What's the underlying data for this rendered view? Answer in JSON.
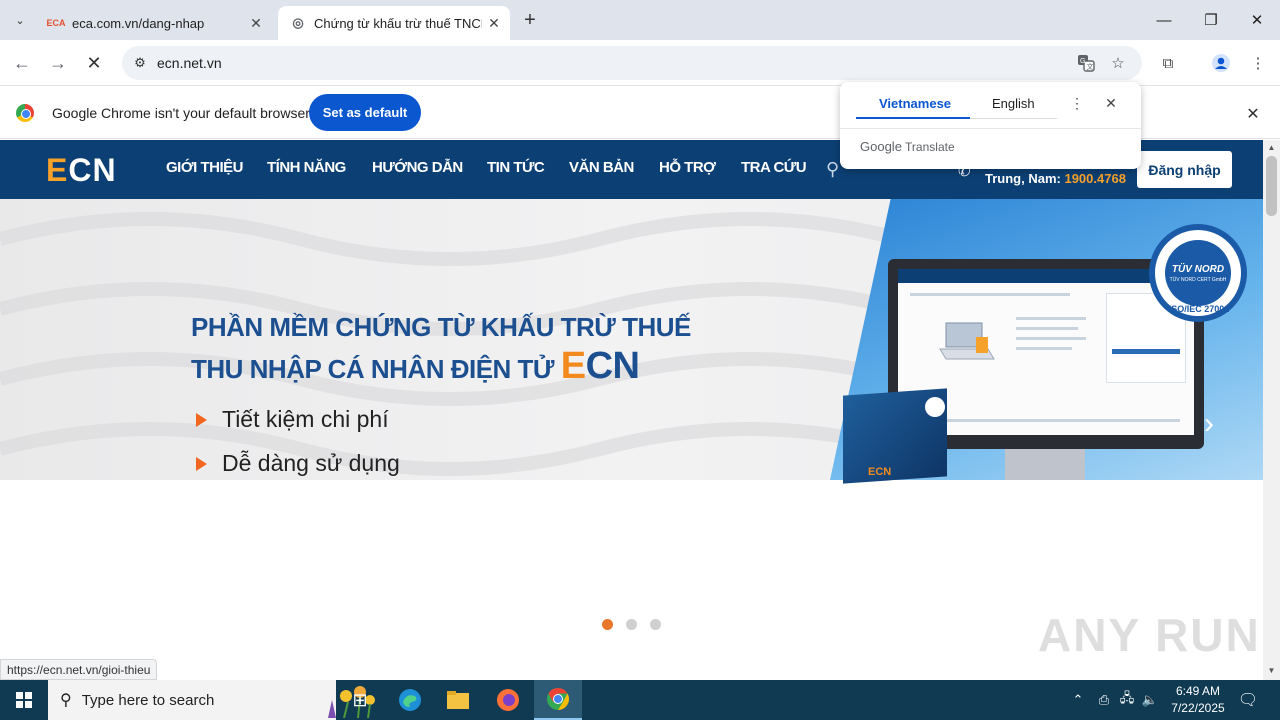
{
  "browser": {
    "tabs": [
      {
        "favicon": "ECA",
        "title": "eca.com.vn/dang-nhap"
      },
      {
        "favicon": "globe-icon",
        "title": "Chứng từ khấu trừ thuế TNCN điện tử"
      }
    ],
    "url": "ecn.net.vn",
    "infobar": {
      "text": "Google Chrome isn't your default browser",
      "button": "Set as default"
    },
    "status_url": "https://ecn.net.vn/gioi-thieu"
  },
  "translate_popup": {
    "tabs": [
      "Vietnamese",
      "English"
    ],
    "selected": "Vietnamese",
    "brand": "Google",
    "product": "Translate"
  },
  "site": {
    "logo_e": "E",
    "logo_rest": "CN",
    "menu": [
      "GIỚI THIỆU",
      "TÍNH NĂNG",
      "HƯỚNG DẪN",
      "TIN TỨC",
      "VĂN BẢN",
      "HỖ TRỢ",
      "TRA CỨU"
    ],
    "hotline_label": "Trung, Nam:",
    "hotline_number": "1900.4768",
    "login": "Đăng nhập",
    "banner": {
      "line1": "PHẦN MỀM CHỨNG TỪ KHẤU TRỪ THUẾ",
      "line2": "THU NHẬP CÁ NHÂN ĐIỆN TỬ",
      "brand_e": "E",
      "brand_rest": "CN",
      "bullets": [
        "Tiết kiệm chi phí",
        "Dễ dàng sử dụng"
      ],
      "box_label": "ECN",
      "cert_name": "TÜV NORD",
      "cert_sub": "TÜV NORD CERT GmbH",
      "cert_iso": "ISO/IEC 27001"
    },
    "carousel": {
      "count": 3,
      "active": 0,
      "active_color": "#e8762b",
      "inactive_color": "#cfcfcf"
    }
  },
  "watermark": "ANY RUN",
  "taskbar": {
    "search_placeholder": "Type here to search",
    "time": "6:49 AM",
    "date": "7/22/2025"
  },
  "colors": {
    "site_nav": "#0c3f73",
    "accent": "#f6a12a",
    "chrome_blue": "#0b57d0"
  }
}
